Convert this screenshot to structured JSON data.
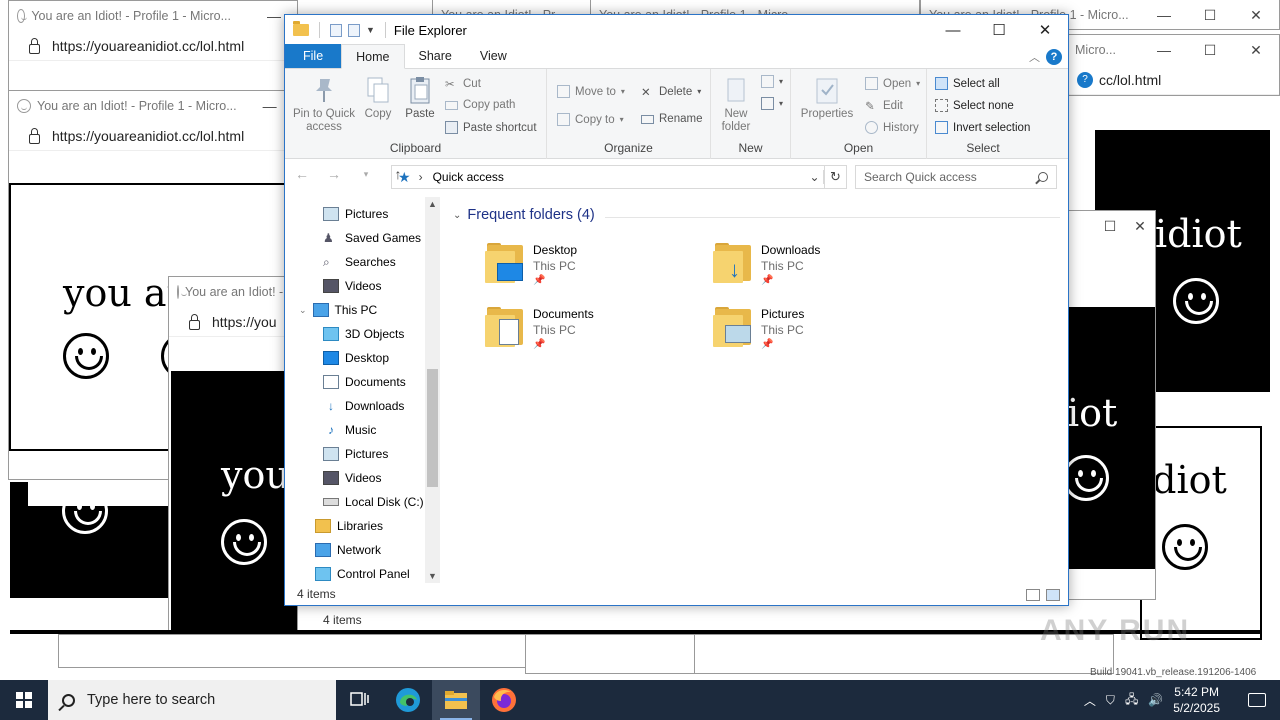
{
  "background_windows": {
    "win1": {
      "title": "You are an Idiot! - Profile 1 - Micro...",
      "url": "https://youareanidiot.cc/lol.html"
    },
    "win2": {
      "title": "You are an Idiot! - Profile 1 - Micro...",
      "url": "https://youareanidiot.cc/lol.html"
    },
    "win3": {
      "title": "You are an Idiot! - Profile 1 - Micro...",
      "url": "https://you"
    },
    "win_top_mid1": {
      "title": "You are an Idiot! - Pr"
    },
    "win_top_mid2": {
      "title": "You are an Idiot! - Profile 1 - Micro"
    },
    "win_top_right": {
      "title": "You are an Idiot! - Profile 1 - Micro..."
    },
    "win_right": {
      "title": "Micro...",
      "url": "cc/lol.html"
    },
    "page_text_1": "you are",
    "page_text_2": "you",
    "page_text_3": "idiot",
    "page_text_4": "iot",
    "page_text_5": "idiot"
  },
  "explorer": {
    "title": "File Explorer",
    "tabs": [
      "File",
      "Home",
      "Share",
      "View"
    ],
    "clipboard": {
      "pin": "Pin to Quick access",
      "copy": "Copy",
      "paste": "Paste",
      "cut": "Cut",
      "copy_path": "Copy path",
      "paste_shortcut": "Paste shortcut",
      "label": "Clipboard"
    },
    "organize": {
      "move_to": "Move to",
      "copy_to": "Copy to",
      "delete": "Delete",
      "rename": "Rename",
      "label": "Organize"
    },
    "new": {
      "new_folder": "New folder",
      "label": "New"
    },
    "open": {
      "properties": "Properties",
      "open": "Open",
      "edit": "Edit",
      "history": "History",
      "label": "Open"
    },
    "select": {
      "select_all": "Select all",
      "select_none": "Select none",
      "invert": "Invert selection",
      "label": "Select"
    },
    "address": "Quick access",
    "search_placeholder": "Search Quick access",
    "nav_items": [
      "Pictures",
      "Saved Games",
      "Searches",
      "Videos",
      "This PC",
      "3D Objects",
      "Desktop",
      "Documents",
      "Downloads",
      "Music",
      "Pictures",
      "Videos",
      "Local Disk (C:)",
      "Libraries",
      "Network",
      "Control Panel"
    ],
    "section_title": "Frequent folders (4)",
    "folders": [
      {
        "name": "Desktop",
        "location": "This PC"
      },
      {
        "name": "Downloads",
        "location": "This PC"
      },
      {
        "name": "Documents",
        "location": "This PC"
      },
      {
        "name": "Pictures",
        "location": "This PC"
      }
    ],
    "status": "4 items"
  },
  "behind_status": "4 items",
  "taskbar": {
    "search_placeholder": "Type here to search",
    "time": "5:42 PM",
    "date": "5/2/2025"
  },
  "watermark": "ANY RUN",
  "build_text": "Build 19041.vb_release.191206-1406"
}
